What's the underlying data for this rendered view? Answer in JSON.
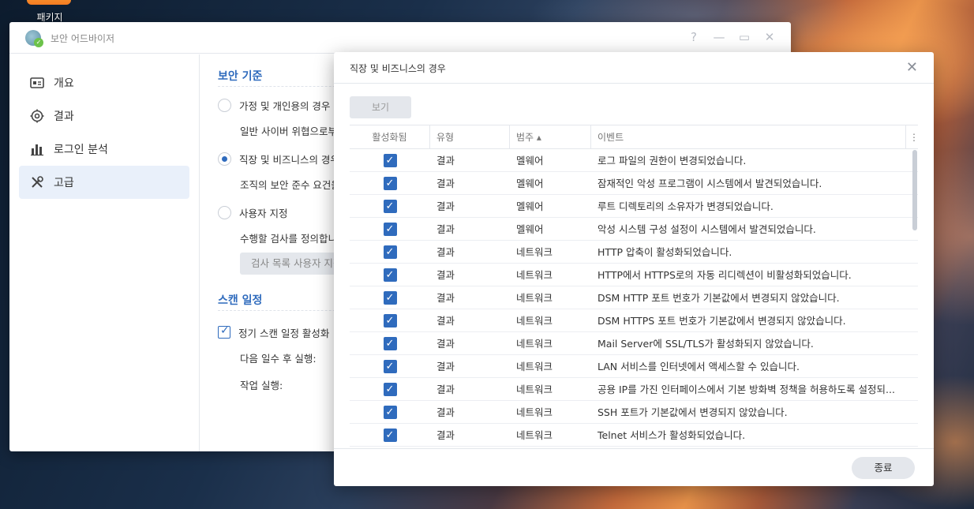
{
  "desktop": {
    "package_label": "패키지"
  },
  "main_window": {
    "title": "보안 어드바이저",
    "controls": {
      "help": "?",
      "minimize": "—",
      "maximize": "▭",
      "close": "✕"
    },
    "sidebar": [
      {
        "label": "개요",
        "icon": "overview-icon"
      },
      {
        "label": "결과",
        "icon": "results-icon"
      },
      {
        "label": "로그인 분석",
        "icon": "chart-icon"
      },
      {
        "label": "고급",
        "icon": "tools-icon",
        "active": true
      }
    ],
    "security_baseline": {
      "title": "보안 기준",
      "home_option": "가정 및 개인용의 경우",
      "home_desc": "일반 사이버 위협으로부",
      "business_option": "직장 및 비즈니스의 경우",
      "business_desc": "조직의 보안 준수 요건을",
      "custom_option": "사용자 지정",
      "custom_desc": "수행할 검사를 정의합니",
      "custom_button": "검사 목록 사용자 지정"
    },
    "scan_schedule": {
      "title": "스캔 일정",
      "enable_label": "정기 스캔 일정 활성화",
      "run_after_label": "다음 일수 후 실행:",
      "run_task_label": "작업 실행:"
    }
  },
  "modal": {
    "title": "직장 및 비즈니스의 경우",
    "close": "✕",
    "view_button": "보기",
    "columns": {
      "enabled": "활성화됨",
      "type": "유형",
      "category": "범주 ▴",
      "event": "이벤트",
      "menu": "⋮"
    },
    "rows": [
      {
        "type": "결과",
        "category": "멜웨어",
        "event": "로그 파일의 권한이 변경되었습니다."
      },
      {
        "type": "결과",
        "category": "멜웨어",
        "event": "잠재적인 악성 프로그램이 시스템에서 발견되었습니다."
      },
      {
        "type": "결과",
        "category": "멜웨어",
        "event": "루트 디렉토리의 소유자가 변경되었습니다."
      },
      {
        "type": "결과",
        "category": "멜웨어",
        "event": "악성 시스템 구성 설정이 시스템에서 발견되었습니다."
      },
      {
        "type": "결과",
        "category": "네트워크",
        "event": "HTTP 압축이 활성화되었습니다."
      },
      {
        "type": "결과",
        "category": "네트워크",
        "event": "HTTP에서 HTTPS로의 자동 리디렉션이 비활성화되었습니다."
      },
      {
        "type": "결과",
        "category": "네트워크",
        "event": "DSM HTTP 포트 번호가 기본값에서 변경되지 않았습니다."
      },
      {
        "type": "결과",
        "category": "네트워크",
        "event": "DSM HTTPS 포트 번호가 기본값에서 변경되지 않았습니다."
      },
      {
        "type": "결과",
        "category": "네트워크",
        "event": "Mail Server에 SSL/TLS가 활성화되지 않았습니다."
      },
      {
        "type": "결과",
        "category": "네트워크",
        "event": "LAN 서비스를 인터넷에서 액세스할 수 있습니다."
      },
      {
        "type": "결과",
        "category": "네트워크",
        "event": "공용 IP를 가진 인터페이스에서 기본 방화벽 정책을 허용하도록 설정되..."
      },
      {
        "type": "결과",
        "category": "네트워크",
        "event": "SSH 포트가 기본값에서 변경되지 않았습니다."
      },
      {
        "type": "결과",
        "category": "네트워크",
        "event": "Telnet 서비스가 활성화되었습니다."
      }
    ],
    "done_button": "종료"
  }
}
